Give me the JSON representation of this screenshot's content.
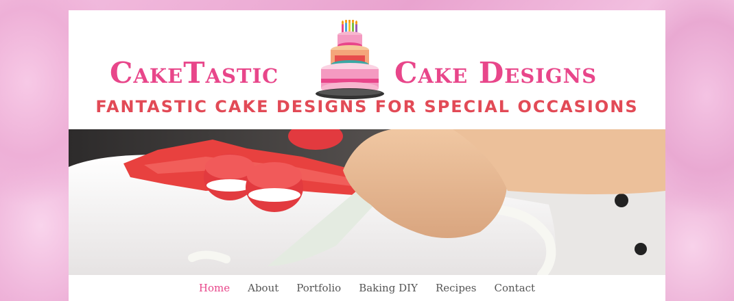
{
  "brand": {
    "name_left": "CakeTastic",
    "name_right": "Cake Designs",
    "tagline": "FANTASTIC CAKE DESIGNS FOR SPECIAL OCCASIONS",
    "logo_icon": "birthday-cake-icon"
  },
  "hero": {
    "image": "cake-decorating-photo"
  },
  "nav": {
    "items": [
      {
        "label": "Home",
        "active": true
      },
      {
        "label": "About"
      },
      {
        "label": "Portfolio"
      },
      {
        "label": "Baking DIY"
      },
      {
        "label": "Recipes"
      },
      {
        "label": "Contact"
      }
    ]
  },
  "colors": {
    "brand_pink": "#e8468a",
    "tagline_red": "#e24a56",
    "nav_text": "#555555"
  }
}
